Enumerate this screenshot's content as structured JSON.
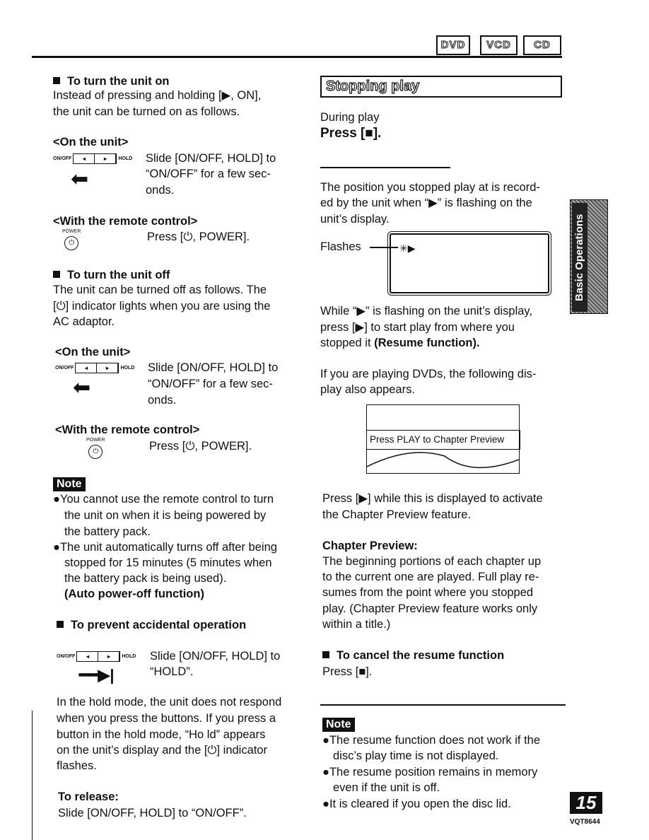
{
  "header": {
    "disc_icons": [
      "DVD",
      "VCD",
      "CD"
    ]
  },
  "left": {
    "turn_on": {
      "heading": "To turn the unit on",
      "lines": [
        "Instead of pressing and holding [▶, ON],",
        "the unit can be turned on as follows."
      ]
    },
    "on_unit_1": {
      "heading": "<On the unit>",
      "switch_left": "ON/OFF",
      "switch_right": "HOLD",
      "lines": [
        "Slide [ON/OFF, HOLD] to",
        "“ON/OFF” for a few sec-",
        "onds."
      ]
    },
    "remote_1": {
      "heading": "<With the remote control>",
      "button_label": "POWER",
      "text": "Press [⏻, POWER]."
    },
    "turn_off": {
      "heading": "To turn the unit off",
      "lines": [
        "The unit can be turned off as follows. The",
        "[⏻] indicator lights when you are using the",
        "AC adaptor."
      ]
    },
    "on_unit_2": {
      "heading": "<On the unit>",
      "switch_left": "ON/OFF",
      "switch_right": "HOLD",
      "lines": [
        "Slide [ON/OFF, HOLD] to",
        "“ON/OFF” for a few sec-",
        "onds."
      ]
    },
    "remote_2": {
      "heading": "<With the remote control>",
      "button_label": "POWER",
      "text": "Press [⏻, POWER]."
    },
    "note": {
      "label": "Note",
      "lines": [
        "●You cannot use the remote control to turn",
        "the unit on when it is being powered by",
        "the battery pack.",
        "●The unit automatically turns off after being",
        "stopped for 15 minutes (5 minutes when",
        "the battery pack is being used)."
      ],
      "bold": "(Auto power-off function)"
    },
    "prevent": {
      "heading": "To prevent accidental operation",
      "switch_left": "ON/OFF",
      "switch_right": "HOLD",
      "lines": [
        "Slide [ON/OFF, HOLD] to",
        "“HOLD”."
      ],
      "para": [
        "In the hold mode, the unit does not respond",
        "when you press the buttons. If you press a",
        "button in the hold mode, “Ho ld” appears",
        "on the unit’s display and the [⏻] indicator",
        "flashes."
      ],
      "release_heading": "To release:",
      "release_text": "Slide [ON/OFF, HOLD] to “ON/OFF”."
    }
  },
  "right": {
    "title": "Stopping play",
    "during": "During play",
    "press": "Press [■].",
    "para1": [
      "The position you stopped play at is record-",
      "ed by the unit when “▶” is flashing on the",
      "unit’s display."
    ],
    "flashes": "Flashes",
    "para2": [
      "While “▶” is flashing on the unit’s display,",
      "press [▶] to start play from where you"
    ],
    "para2_last": "stopped it ",
    "resume_bold": "(Resume function).",
    "para3": [
      "If you are playing DVDs, the following dis-",
      "play also appears."
    ],
    "display_text": "Press PLAY to Chapter Preview",
    "para4": [
      "Press [▶] while this is displayed to activate",
      "the Chapter Preview feature."
    ],
    "chapter_heading": "Chapter Preview:",
    "chapter_lines": [
      "The beginning portions of each chapter up",
      "to the current one are played. Full play re-",
      "sumes from the point where you stopped",
      "play. (Chapter Preview feature works only",
      "within a title.)"
    ],
    "cancel_heading": "To cancel the resume function",
    "cancel_text": "Press [■].",
    "note": {
      "label": "Note",
      "lines": [
        "●The resume function does not work if the",
        "disc’s play time is not displayed.",
        "●The resume position remains in memory",
        "even if the unit is off.",
        "●It is cleared if you open the disc lid."
      ]
    }
  },
  "side_tab": "Basic Operations",
  "footer": {
    "page_number": "15",
    "code": "VQT8644"
  }
}
